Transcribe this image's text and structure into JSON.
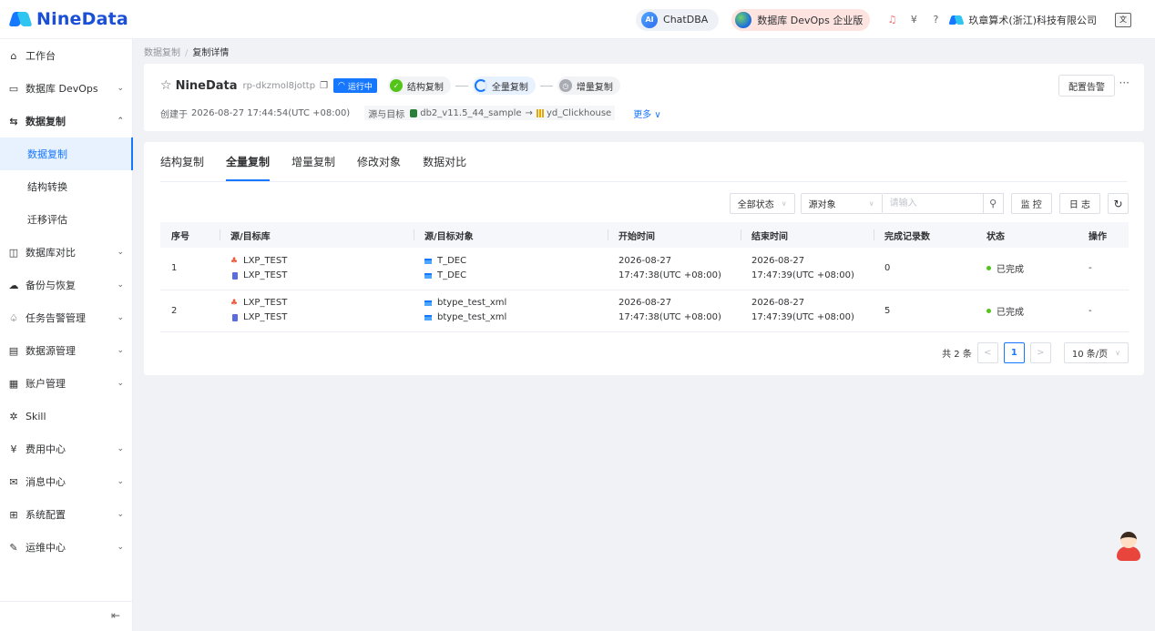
{
  "brand": {
    "name": "NineData"
  },
  "topbar": {
    "chatdba": {
      "badge": "AI",
      "label": "ChatDBA"
    },
    "devops": {
      "label": "数据库 DevOps 企业版"
    },
    "icons": [
      "bell-icon",
      "currency-icon",
      "help-icon"
    ],
    "company": "玖章算术(浙江)科技有限公司",
    "lang_icon": "文"
  },
  "sidebar": {
    "items": [
      {
        "label": "工作台",
        "icon": "⌂",
        "icon_name": "home-icon",
        "chevron": ""
      },
      {
        "label": "数据库 DevOps",
        "icon": "▭",
        "icon_name": "devops-icon",
        "chevron": "⌄"
      },
      {
        "label": "数据复制",
        "icon": "⇆",
        "icon_name": "replication-icon",
        "chevron": "⌃"
      },
      {
        "label": "数据库对比",
        "icon": "◫",
        "icon_name": "compare-icon",
        "chevron": "⌄"
      },
      {
        "label": "备份与恢复",
        "icon": "☁",
        "icon_name": "backup-icon",
        "chevron": "⌄"
      },
      {
        "label": "任务告警管理",
        "icon": "♤",
        "icon_name": "alarm-icon",
        "chevron": "⌄"
      },
      {
        "label": "数据源管理",
        "icon": "▤",
        "icon_name": "datasource-icon",
        "chevron": "⌄"
      },
      {
        "label": "账户管理",
        "icon": "▦",
        "icon_name": "account-icon",
        "chevron": "⌄"
      },
      {
        "label": "Skill",
        "icon": "✲",
        "icon_name": "skill-icon",
        "chevron": ""
      },
      {
        "label": "费用中心",
        "icon": "¥",
        "icon_name": "billing-icon",
        "chevron": "⌄"
      },
      {
        "label": "消息中心",
        "icon": "✉",
        "icon_name": "message-icon",
        "chevron": "⌄"
      },
      {
        "label": "系统配置",
        "icon": "⊞",
        "icon_name": "settings-icon",
        "chevron": "⌄"
      },
      {
        "label": "运维中心",
        "icon": "✎",
        "icon_name": "ops-icon",
        "chevron": "⌄"
      }
    ],
    "sub_items": [
      "数据复制",
      "结构转换",
      "迁移评估"
    ],
    "collapse_icon": "⇤"
  },
  "breadcrumb": {
    "parent": "数据复制",
    "sep": "/",
    "current": "复制详情"
  },
  "task": {
    "name": "NineData",
    "id": "rp-dkzmol8jottp",
    "status": "运行中",
    "stages": [
      "结构复制",
      "全量复制",
      "增量复制"
    ],
    "created_label": "创建于",
    "created_at": "2026-08-27 17:44:54(UTC +08:00)",
    "src_tgt_label": "源与目标",
    "source": "db2_v11.5_44_sample",
    "arrow": "→",
    "target": "yd_Clickhouse",
    "more": "更多",
    "alert_button": "配置告警",
    "more_dots": "···"
  },
  "tabs": [
    "结构复制",
    "全量复制",
    "增量复制",
    "修改对象",
    "数据对比"
  ],
  "active_tab": 1,
  "filters": {
    "status": "全部状态",
    "source_object": "源对象",
    "search_placeholder": "请输入",
    "monitor": "监 控",
    "log": "日 志"
  },
  "table": {
    "columns": [
      "序号",
      "源/目标库",
      "源/目标对象",
      "开始时间",
      "结束时间",
      "完成记录数",
      "状态",
      "操作"
    ],
    "rows": [
      {
        "no": "1",
        "src_db": "LXP_TEST",
        "tgt_db": "LXP_TEST",
        "src_obj": "T_DEC",
        "tgt_obj": "T_DEC",
        "start_date": "2026-08-27",
        "start_time": "17:47:38(UTC +08:00)",
        "end_date": "2026-08-27",
        "end_time": "17:47:39(UTC +08:00)",
        "records": "0",
        "status": "已完成",
        "op": "-"
      },
      {
        "no": "2",
        "src_db": "LXP_TEST",
        "tgt_db": "LXP_TEST",
        "src_obj": "btype_test_xml",
        "tgt_obj": "btype_test_xml",
        "start_date": "2026-08-27",
        "start_time": "17:47:38(UTC +08:00)",
        "end_date": "2026-08-27",
        "end_time": "17:47:39(UTC +08:00)",
        "records": "5",
        "status": "已完成",
        "op": "-"
      }
    ]
  },
  "pagination": {
    "total": "共 2 条",
    "prev": "<",
    "page": "1",
    "next": ">",
    "page_size": "10 条/页"
  },
  "colors": {
    "primary": "#1677ff",
    "success": "#52c41a",
    "brand": "#1a4fd6"
  }
}
